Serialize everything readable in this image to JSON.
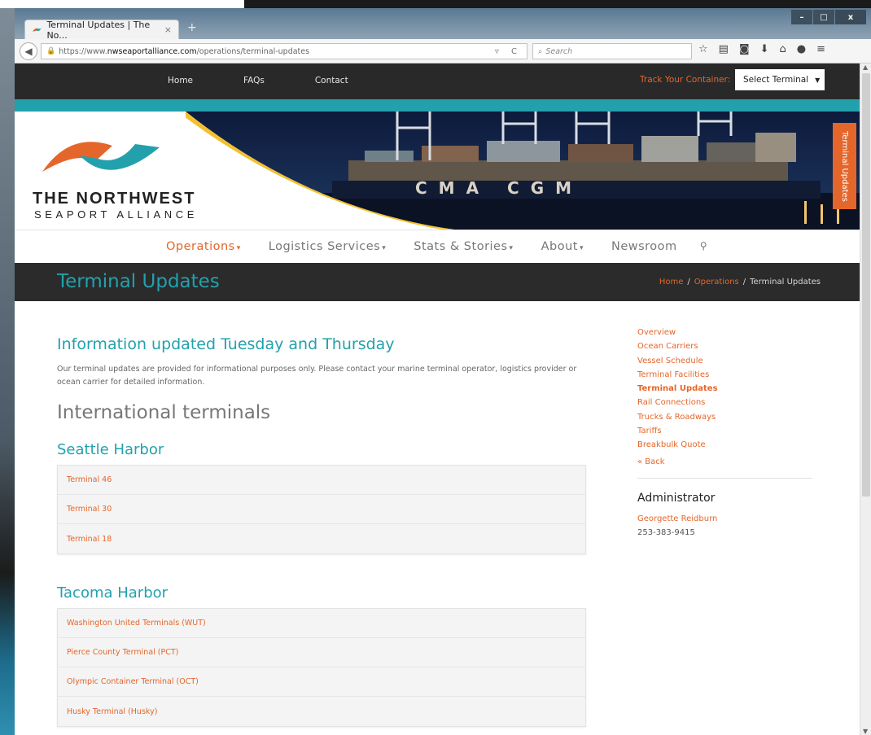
{
  "browser": {
    "tab_title": "Terminal Updates | The No...",
    "tab_close": "×",
    "new_tab": "+",
    "win_minimize": "–",
    "win_maximize": "□",
    "win_close": "x",
    "url_prefix": "https://www.",
    "url_domain": "nwseaportalliance.com",
    "url_path": "/operations/terminal-updates",
    "search_placeholder": "Search"
  },
  "topnav": {
    "links": [
      "Home",
      "FAQs",
      "Contact"
    ],
    "track_label": "Track Your Container:",
    "select_value": "Select Terminal"
  },
  "logo": {
    "line1": "THE NORTHWEST",
    "line2": "SEAPORT ALLIANCE"
  },
  "hero": {
    "ship_text": "CMA CGM"
  },
  "side_tab": "Terminal Updates",
  "mainnav": {
    "items": [
      "Operations",
      "Logistics Services",
      "Stats & Stories",
      "About",
      "Newsroom"
    ]
  },
  "page": {
    "title": "Terminal Updates",
    "breadcrumb": [
      "Home",
      "Operations",
      "Terminal Updates"
    ],
    "breadcrumb_sep": "/"
  },
  "content": {
    "heading": "Information updated Tuesday and Thursday",
    "intro": "Our terminal updates are provided for informational purposes only. Please contact your marine terminal operator, logistics provider or ocean carrier for detailed information.",
    "section": "International terminals",
    "harbors": [
      {
        "name": "Seattle Harbor",
        "terminals": [
          "Terminal 46",
          "Terminal 30",
          "Terminal 18"
        ]
      },
      {
        "name": "Tacoma Harbor",
        "terminals": [
          "Washington United Terminals (WUT)",
          "Pierce County Terminal (PCT)",
          "Olympic Container Terminal (OCT)",
          "Husky Terminal (Husky)"
        ]
      }
    ]
  },
  "sidebar": {
    "links": [
      "Overview",
      "Ocean Carriers",
      "Vessel Schedule",
      "Terminal Facilities",
      "Terminal Updates",
      "Rail Connections",
      "Trucks & Roadways",
      "Tariffs",
      "Breakbulk Quote"
    ],
    "current": "Terminal Updates",
    "back": "« Back",
    "admin_title": "Administrator",
    "admin_name": "Georgette Reidburn",
    "admin_phone": "253-383-9415"
  },
  "colors": {
    "accent_orange": "#e4662a",
    "accent_teal": "#22a1ad",
    "dark_bar": "#292929"
  }
}
